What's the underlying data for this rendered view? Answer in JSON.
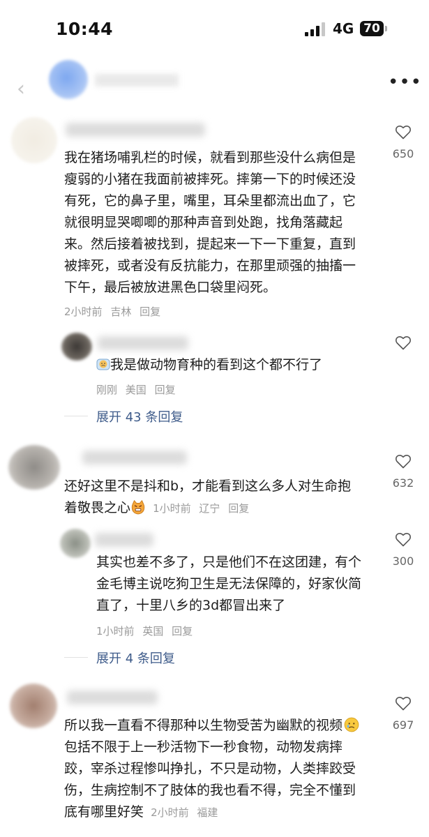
{
  "status_bar": {
    "time": "10:44",
    "network": "4G",
    "battery": "70"
  },
  "icons": {
    "back": "chevron-left-icon",
    "more": "more-horizontal-icon",
    "like": "heart-outline-icon"
  },
  "comments": [
    {
      "text": "我在猪场哺乳栏的时候，就看到那些没什么病但是瘦弱的小猪在我面前被摔死。摔第一下的时候还没有死，它的鼻子里，嘴里，耳朵里都流出血了，它就很明显哭唧唧的那种声音到处跑，找角落藏起来。然后接着被找到，提起来一下一下重复，直到被摔死，或者没有反抗能力，在那里顽强的抽搐一下午，最后被放进黑色口袋里闷死。",
      "lines": [
        "我在猪场哺乳栏的时候，就看到那些没什么病但是",
        "瘦弱的小猪在我面前被摔死。摔第一下的时候还没",
        "有死，它的鼻子里，嘴里，耳朵里都流出血了，它",
        "就很明显哭唧唧的那种声音到处跑，找角落藏起",
        "来。然后接着被找到，提起来一下一下重复，直到",
        "被摔死，或者没有反抗能力，在那里顽强的抽搐一",
        "下午，最后被放进黑色口袋里闷死。"
      ],
      "time": "2小时前",
      "location": "吉林",
      "reply": "回复",
      "likes": "650",
      "replies": [
        {
          "text": "我是做动物育种的看到这个都不行了",
          "time": "刚刚",
          "location": "美国",
          "reply": "回复"
        }
      ],
      "expand": "展开 43 条回复"
    },
    {
      "lines": [
        "还好这里不是抖和b，才能看到这么多人对生命抱",
        "着敬畏之心"
      ],
      "time": "1小时前",
      "location": "辽宁",
      "reply": "回复",
      "likes": "632",
      "replies": [
        {
          "lines": [
            "其实也差不多了，只是他们不在这团建，有个",
            "金毛博主说吃狗卫生是无法保障的，好家伙简",
            "直了，十里八乡的3d都冒出来了"
          ],
          "time": "1小时前",
          "location": "英国",
          "reply": "回复",
          "likes": "300"
        }
      ],
      "expand": "展开 4 条回复"
    },
    {
      "lines": [
        "所以我一直看不得那种以生物受苦为幽默的视频",
        "包括不限于上一秒活物下一秒食物，动物发病摔",
        "跤，宰杀过程惨叫挣扎，不只是动物，人类摔跤受",
        "伤，生病控制不了肢体的我也看不得，完全不懂到",
        "底有哪里好笑"
      ],
      "time": "2小时前",
      "location": "福建",
      "likes": "697"
    }
  ]
}
